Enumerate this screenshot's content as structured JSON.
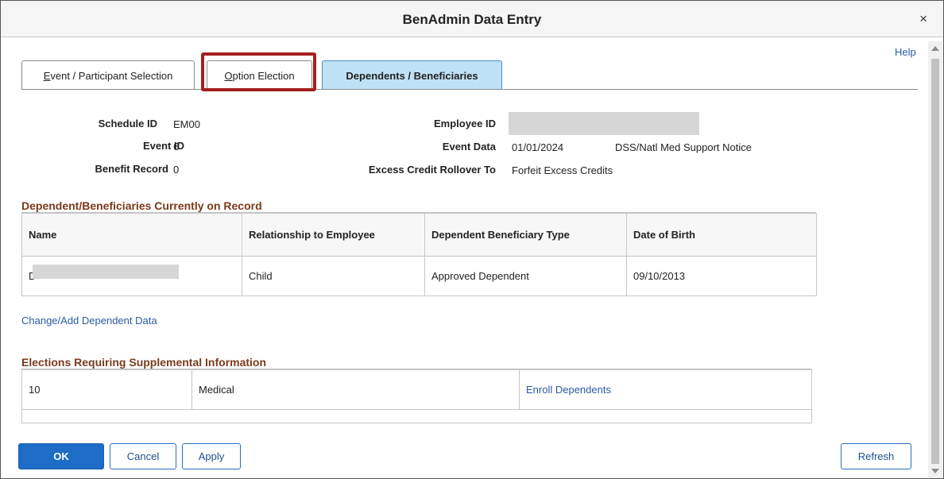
{
  "window": {
    "title": "BenAdmin Data Entry",
    "close_symbol": "×"
  },
  "help_label": "Help",
  "tabs": [
    {
      "label": "Event / Participant Selection",
      "first_letter": "E",
      "rest": "vent / Participant Selection"
    },
    {
      "label": "Option Election",
      "first_letter": "O",
      "rest": "ption Election"
    },
    {
      "label": "Dependents / Beneficiaries"
    }
  ],
  "info": {
    "schedule_id_label": "Schedule ID",
    "schedule_id": "EM00",
    "event_id_label": "Event ID",
    "event_id": "6",
    "benefit_record_label": "Benefit Record",
    "benefit_record": "0",
    "employee_id_label": "Employee ID",
    "event_data_label": "Event Data",
    "event_date": "01/01/2024",
    "event_desc": "DSS/Natl Med Support Notice",
    "excess_label": "Excess Credit Rollover To",
    "excess_value": "Forfeit Excess Credits"
  },
  "dependents": {
    "title": "Dependent/Beneficiaries Currently on Record",
    "columns": [
      "Name",
      "Relationship to Employee",
      "Dependent Beneficiary Type",
      "Date of Birth"
    ],
    "rows": [
      {
        "name": "D",
        "relationship": "Child",
        "type": "Approved Dependent",
        "dob": "09/10/2013"
      }
    ]
  },
  "change_link": "Change/Add Dependent Data",
  "elections": {
    "title": "Elections Requiring Supplemental Information",
    "rows": [
      {
        "code": "10",
        "plan": "Medical",
        "action": "Enroll Dependents"
      }
    ]
  },
  "buttons": {
    "ok": "OK",
    "cancel": "Cancel",
    "apply": "Apply",
    "refresh": "Refresh"
  },
  "colors": {
    "accent": "#1d6dc7",
    "active_tab": "#bfe1f6",
    "highlight_border": "#a32020",
    "section_title": "#7a3a1c",
    "link": "#2a5ba0"
  }
}
